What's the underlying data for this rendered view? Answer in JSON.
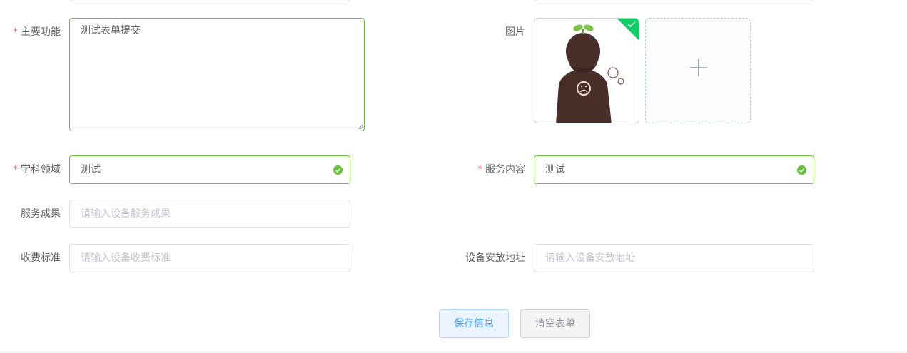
{
  "form": {
    "main_function": {
      "required_mark": "*",
      "label": "主要功能",
      "value": "测试表单提交"
    },
    "image": {
      "label": "图片"
    },
    "subject_area": {
      "required_mark": "*",
      "label": "学科领域",
      "value": "测试"
    },
    "service_content": {
      "required_mark": "*",
      "label": "服务内容",
      "value": "测试"
    },
    "service_result": {
      "label": "服务成果",
      "placeholder": "请输入设备服务成果"
    },
    "fee_standard": {
      "label": "收费标准",
      "placeholder": "请输入设备收费标准"
    },
    "install_address": {
      "label": "设备安放地址",
      "placeholder": "请输入设备安放地址"
    }
  },
  "buttons": {
    "save_label": "保存信息",
    "clear_label": "清空表单"
  },
  "colors": {
    "success": "#67c23a",
    "required": "#f56c6c",
    "primary": "#409eff",
    "upload_success": "#13ce66"
  },
  "icons": {
    "check": "circle-check-icon",
    "plus": "plus-icon",
    "upload_success": "check-icon"
  }
}
